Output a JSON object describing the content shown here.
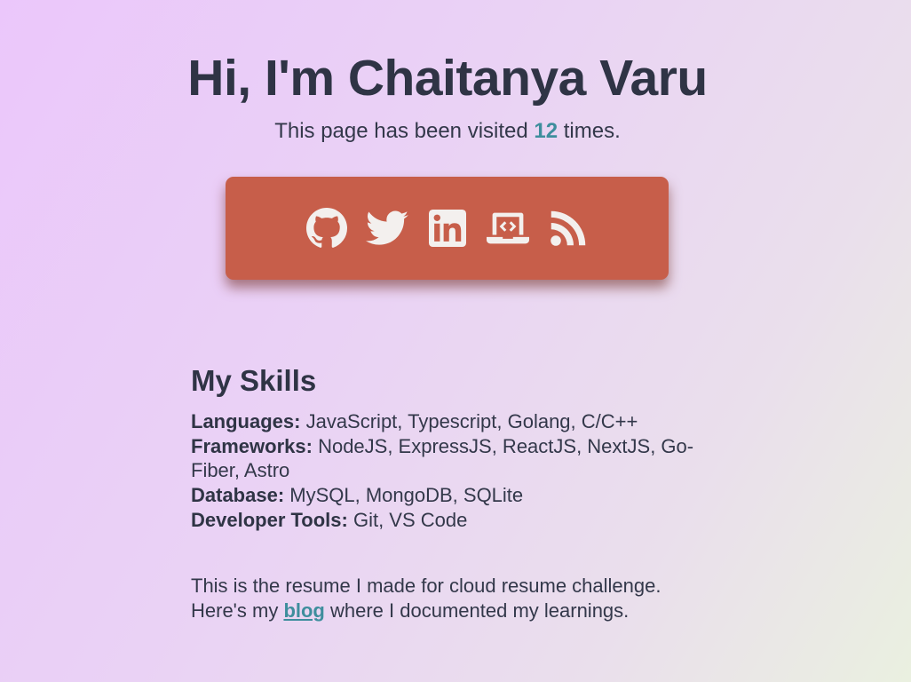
{
  "header": {
    "title": "Hi, I'm Chaitanya Varu",
    "visits_prefix": "This page has been visited ",
    "visits_count": "12",
    "visits_suffix": " times."
  },
  "social": {
    "background": "#c75e4a",
    "icon_color": "#f3f0ee",
    "links": [
      {
        "icon": "github-icon"
      },
      {
        "icon": "twitter-icon"
      },
      {
        "icon": "linkedin-icon"
      },
      {
        "icon": "laptop-code-icon"
      },
      {
        "icon": "rss-icon"
      }
    ]
  },
  "skills": {
    "heading": "My Skills",
    "items": [
      {
        "label": "Languages:",
        "value": " JavaScript, Typescript, Golang, C/C++"
      },
      {
        "label": "Frameworks:",
        "value": " NodeJS, ExpressJS, ReactJS, NextJS, Go-Fiber, Astro"
      },
      {
        "label": "Database:",
        "value": " MySQL, MongoDB, SQLite"
      },
      {
        "label": "Developer Tools:",
        "value": " Git, VS Code"
      }
    ]
  },
  "outro": {
    "line1": "This is the resume I made for cloud resume challenge.",
    "line2_prefix": "Here's my ",
    "link_text": "blog",
    "line2_suffix": " where I documented my learnings."
  },
  "colors": {
    "accent": "#3e8e9d",
    "text": "#2f3445"
  }
}
